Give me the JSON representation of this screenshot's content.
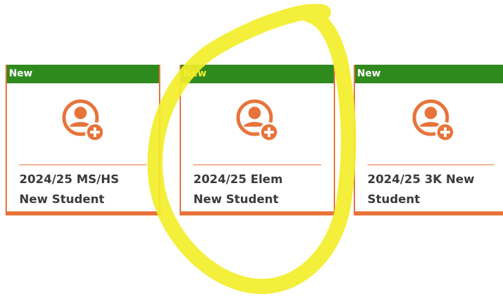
{
  "cards": [
    {
      "badge": "New",
      "title_line1": "2024/25 MS/HS",
      "title_line2": "New Student",
      "icon": "add-user-icon"
    },
    {
      "badge": "New",
      "title_line1": "2024/25 Elem",
      "title_line2": "New Student",
      "icon": "add-user-icon"
    },
    {
      "badge": "New",
      "title_line1": "2024/25 3K New",
      "title_line2": "Student",
      "icon": "add-user-icon"
    }
  ],
  "colors": {
    "header_green": "#2f8a1e",
    "accent_orange": "#e8733a",
    "highlight_yellow": "#f2ee2a",
    "label_text": "#3a3a3a"
  }
}
